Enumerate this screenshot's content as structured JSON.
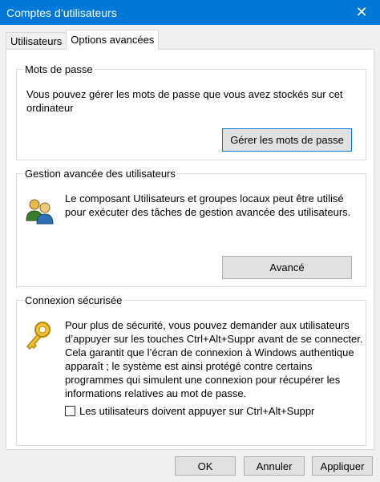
{
  "window": {
    "title": "Comptes d’utilisateurs",
    "close_glyph": "✕"
  },
  "tabs": [
    {
      "label": "Utilisateurs",
      "active": false
    },
    {
      "label": "Options avancées",
      "active": true
    }
  ],
  "passwords": {
    "title": "Mots de passe",
    "description": "Vous pouvez gérer les mots de passe que vous avez stockés sur cet ordinateur",
    "button": "Gérer les mots de passe"
  },
  "advanced": {
    "title": "Gestion avancée des utilisateurs",
    "description": "Le composant Utilisateurs et groupes locaux peut être utilisé pour exécuter des tâches de gestion avancée des utilisateurs.",
    "button": "Avancé",
    "icon": "users-icon"
  },
  "secure": {
    "title": "Connexion sécurisée",
    "description": "Pour plus de sécurité, vous pouvez demander aux utilisateurs d’appuyer sur les touches Ctrl+Alt+Suppr avant de se connecter. Cela garantit que l’écran de connexion à Windows authentique apparaît ; le système est ainsi protégé contre certains programmes qui simulent une connexion pour récupérer les informations relatives au mot de passe.",
    "checkbox_label": "Les utilisateurs doivent appuyer sur Ctrl+Alt+Suppr",
    "checkbox_checked": false,
    "icon": "key-icon"
  },
  "footer": {
    "ok": "OK",
    "cancel": "Annuler",
    "apply": "Appliquer"
  },
  "colors": {
    "titlebar": "#0078d7",
    "button": "#e1e1e1",
    "accent": "#0078d7"
  }
}
